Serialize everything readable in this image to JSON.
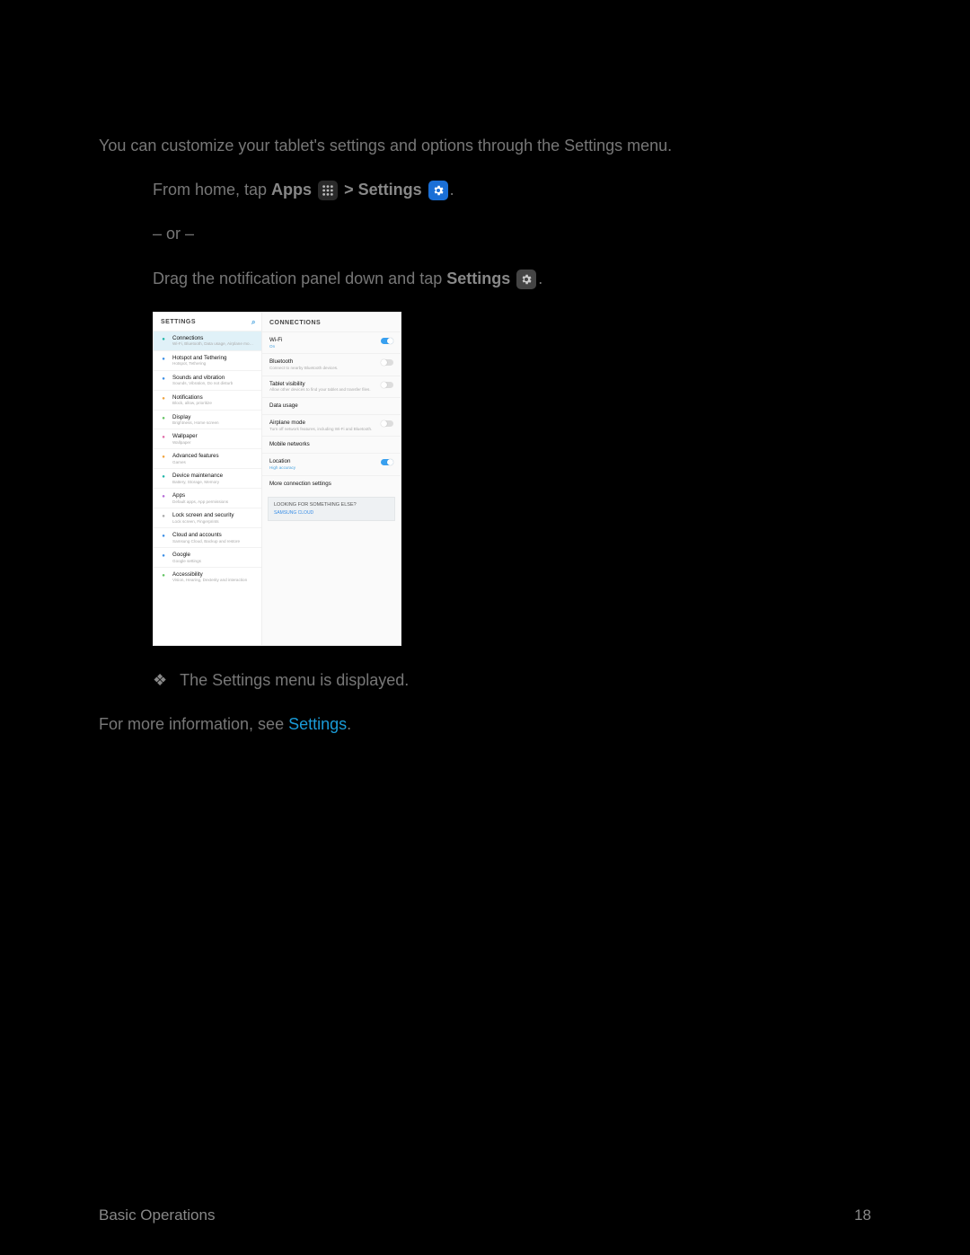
{
  "intro": "You can customize your tablet's settings and options through the Settings menu.",
  "step1": {
    "pre": "From home, tap ",
    "apps": "Apps",
    "mid": " > ",
    "settings": "Settings",
    "post": "."
  },
  "or": "– or –",
  "step2": {
    "pre": "Drag the notification panel down and tap ",
    "settings": "Settings",
    "post": "."
  },
  "bullet": {
    "sym": "❖",
    "text": "The Settings menu is displayed."
  },
  "more": {
    "pre": "For more information, see ",
    "link": "Settings",
    "post": "."
  },
  "footer": {
    "left": "Basic Operations",
    "right": "18"
  },
  "device": {
    "left_header": "SETTINGS",
    "items": [
      {
        "t1": "Connections",
        "t2": "Wi-Fi, Bluetooth, Data usage, Airplane mo…",
        "ic": "ic-teal",
        "sel": true
      },
      {
        "t1": "Hotspot and Tethering",
        "t2": "Hotspot, Tethering",
        "ic": "ic-blue"
      },
      {
        "t1": "Sounds and vibration",
        "t2": "Sounds, Vibration, Do not disturb",
        "ic": "ic-blue"
      },
      {
        "t1": "Notifications",
        "t2": "Block, allow, prioritize",
        "ic": "ic-orange"
      },
      {
        "t1": "Display",
        "t2": "Brightness, Home screen",
        "ic": "ic-green"
      },
      {
        "t1": "Wallpaper",
        "t2": "Wallpaper",
        "ic": "ic-pink"
      },
      {
        "t1": "Advanced features",
        "t2": "Games",
        "ic": "ic-orange"
      },
      {
        "t1": "Device maintenance",
        "t2": "Battery, Storage, Memory",
        "ic": "ic-teal"
      },
      {
        "t1": "Apps",
        "t2": "Default apps, App permissions",
        "ic": "ic-purple"
      },
      {
        "t1": "Lock screen and security",
        "t2": "Lock screen, Fingerprints",
        "ic": "ic-gray"
      },
      {
        "t1": "Cloud and accounts",
        "t2": "Samsung Cloud, Backup and restore",
        "ic": "ic-blue"
      },
      {
        "t1": "Google",
        "t2": "Google settings",
        "ic": "ic-blue"
      },
      {
        "t1": "Accessibility",
        "t2": "Vision, Hearing, Dexterity and interaction",
        "ic": "ic-green"
      }
    ],
    "right_header": "CONNECTIONS",
    "ritems": [
      {
        "t1": "Wi-Fi",
        "t2": "On",
        "t2c": "",
        "toggle": "on"
      },
      {
        "t1": "Bluetooth",
        "t2": "Connect to nearby Bluetooth devices.",
        "t2c": "gray",
        "toggle": "off"
      },
      {
        "t1": "Tablet visibility",
        "t2": "Allow other devices to find your tablet and transfer files.",
        "t2c": "gray",
        "toggle": "off"
      },
      {
        "t1": "Data usage",
        "t2": "",
        "toggle": ""
      },
      {
        "t1": "Airplane mode",
        "t2": "Turn off network features, including Wi-Fi and Bluetooth.",
        "t2c": "gray",
        "toggle": "off"
      },
      {
        "t1": "Mobile networks",
        "t2": "",
        "toggle": ""
      },
      {
        "t1": "Location",
        "t2": "High accuracy",
        "t2c": "",
        "toggle": "on"
      },
      {
        "t1": "More connection settings",
        "t2": "",
        "toggle": ""
      }
    ],
    "look": {
      "l1": "LOOKING FOR SOMETHING ELSE?",
      "l2": "SAMSUNG CLOUD"
    }
  }
}
